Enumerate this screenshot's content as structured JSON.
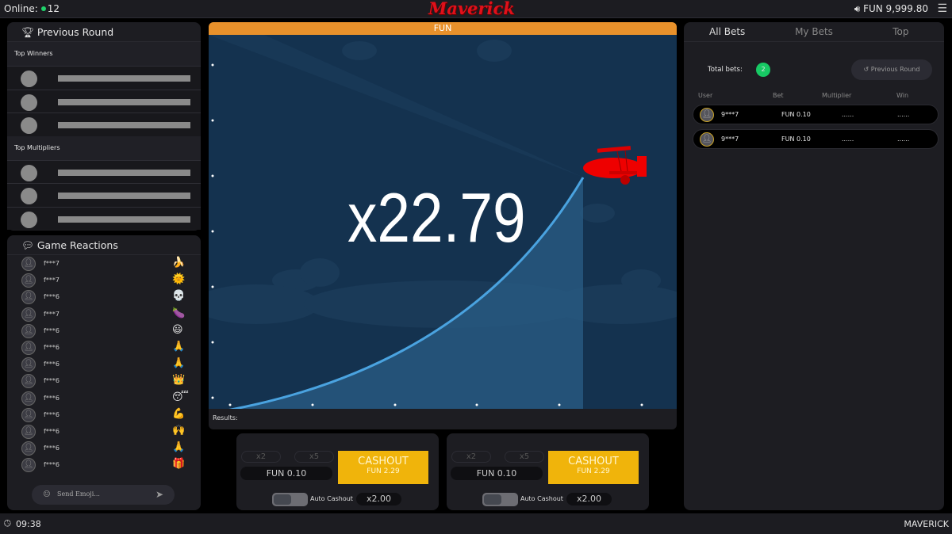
{
  "topbar": {
    "online_label": "Online:",
    "online_count": "12",
    "logo": "Maverick",
    "balance": "FUN 9,999.80",
    "icons": [
      "sound-icon",
      "menu-icon"
    ]
  },
  "previous_round": {
    "title": "Previous Round",
    "top_winners": "Top Winners",
    "top_multipliers": "Top Multipliers"
  },
  "reactions": {
    "title": "Game Reactions",
    "input_placeholder": "Send Emoji...",
    "items": [
      {
        "user": "f***7",
        "emoji": "🍌"
      },
      {
        "user": "f***7",
        "emoji": "🌞"
      },
      {
        "user": "f***6",
        "emoji": "💀"
      },
      {
        "user": "f***7",
        "emoji": "🍆"
      },
      {
        "user": "f***6",
        "emoji": "😃"
      },
      {
        "user": "f***6",
        "emoji": "🙏"
      },
      {
        "user": "f***6",
        "emoji": "🙏"
      },
      {
        "user": "f***6",
        "emoji": "👑"
      },
      {
        "user": "f***6",
        "emoji": "😴"
      },
      {
        "user": "f***6",
        "emoji": "💪"
      },
      {
        "user": "f***6",
        "emoji": "🙌"
      },
      {
        "user": "f***6",
        "emoji": "🙏"
      },
      {
        "user": "f***6",
        "emoji": "🎁"
      }
    ]
  },
  "game": {
    "mode": "FUN",
    "multiplier": "x22.79",
    "results_label": "Results:",
    "header_color": "#e8912b",
    "sky_color": "#14324f",
    "curve_color": "#4aa3e0"
  },
  "bet_panels": [
    {
      "x2": "x2",
      "x5": "x5",
      "amount": "FUN 0.10",
      "cashout": "CASHOUT",
      "cashout_value": "FUN 2.29",
      "auto_cashout": "Auto Cashout",
      "auto_value": "x2.00",
      "auto_enabled": false
    },
    {
      "x2": "x2",
      "x5": "x5",
      "amount": "FUN 0.10",
      "cashout": "CASHOUT",
      "cashout_value": "FUN 2.29",
      "auto_cashout": "Auto Cashout",
      "auto_value": "x2.00",
      "auto_enabled": false
    }
  ],
  "bets": {
    "tabs": [
      "All Bets",
      "My Bets",
      "Top"
    ],
    "active_tab": "All Bets",
    "total_label": "Total bets:",
    "total": "2",
    "prev_round": "Previous Round",
    "columns": [
      "User",
      "Bet",
      "Multiplier",
      "Win"
    ],
    "rows": [
      {
        "user": "9***7",
        "bet": "FUN 0.10",
        "multiplier": "......",
        "win": "......"
      },
      {
        "user": "9***7",
        "bet": "FUN 0.10",
        "multiplier": "......",
        "win": "......"
      }
    ]
  },
  "bottombar": {
    "time": "09:38",
    "brand": "MAVERICK"
  }
}
